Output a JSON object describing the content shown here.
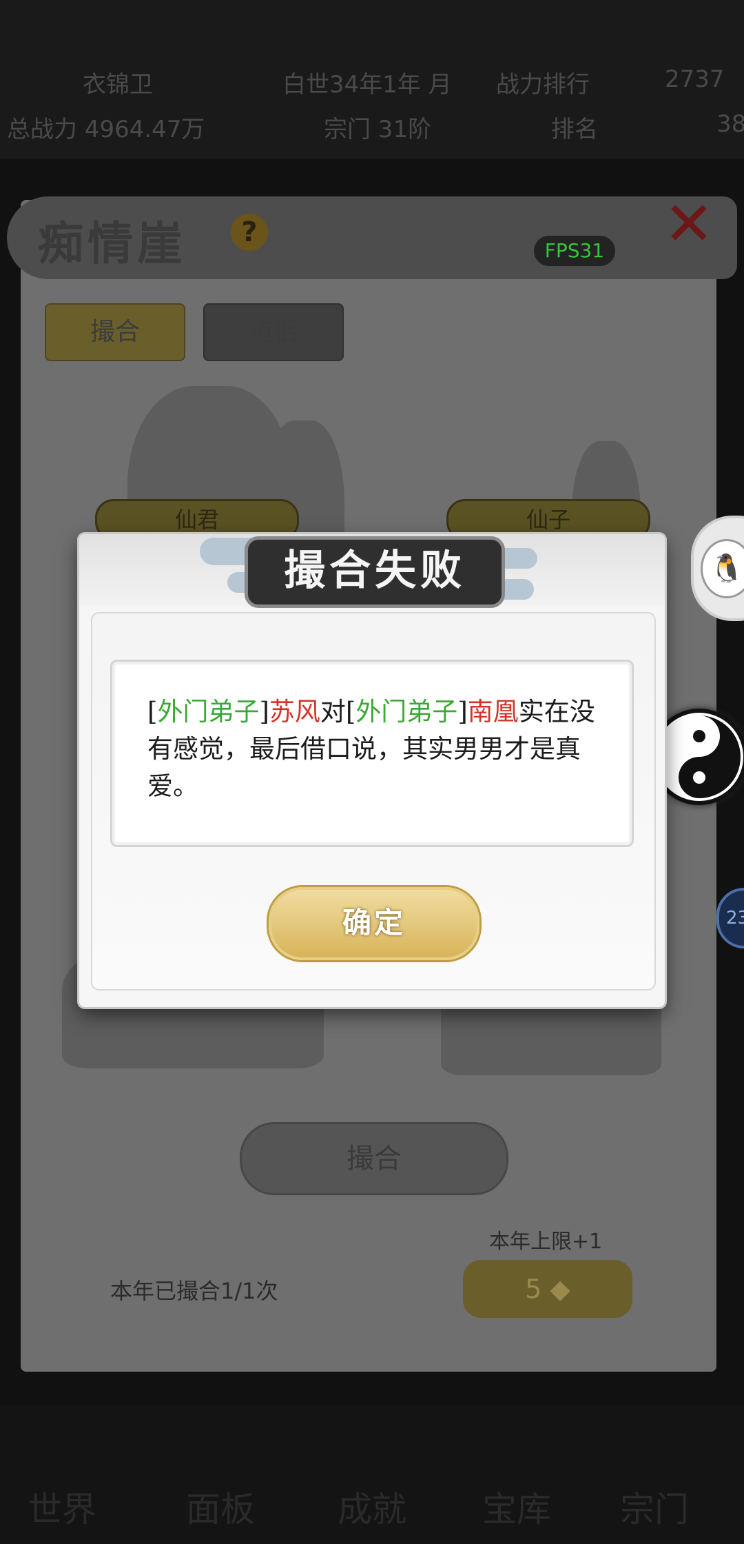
{
  "hud": {
    "row1": [
      "衣锦卫",
      "白世34年1年 月",
      "战力排行",
      "2737"
    ],
    "row2": [
      "总战力 4964.47万",
      "宗门 31阶",
      "排名",
      "38"
    ]
  },
  "panel": {
    "title": "痴情崖",
    "help_symbol": "?",
    "close_symbol": "✕",
    "fps": "FPS31",
    "tabs": [
      "撮合",
      "道侣"
    ],
    "role_left": "仙君",
    "role_right": "仙子",
    "match_button": "撮合",
    "limit_label": "本年上限+1",
    "count_label": "本年已撮合1/1次",
    "cost_button": "5"
  },
  "modal": {
    "title": "撮合失败",
    "message": {
      "bracket_open_1": "[",
      "rank_1": "外门弟子",
      "bracket_close_1": "]",
      "name_1": "苏风",
      "mid": "对",
      "bracket_open_2": "[",
      "rank_2": "外门弟子",
      "bracket_close_2": "]",
      "name_2": "南凰",
      "rest": "实在没有感觉，最后借口说，其实男男才是真爱。"
    },
    "confirm_label": "确定"
  },
  "floating": {
    "qq_icon": "🐧",
    "badge": "23"
  },
  "bottom_nav": [
    "世界",
    "面板",
    "成就",
    "宝库",
    "宗门"
  ]
}
